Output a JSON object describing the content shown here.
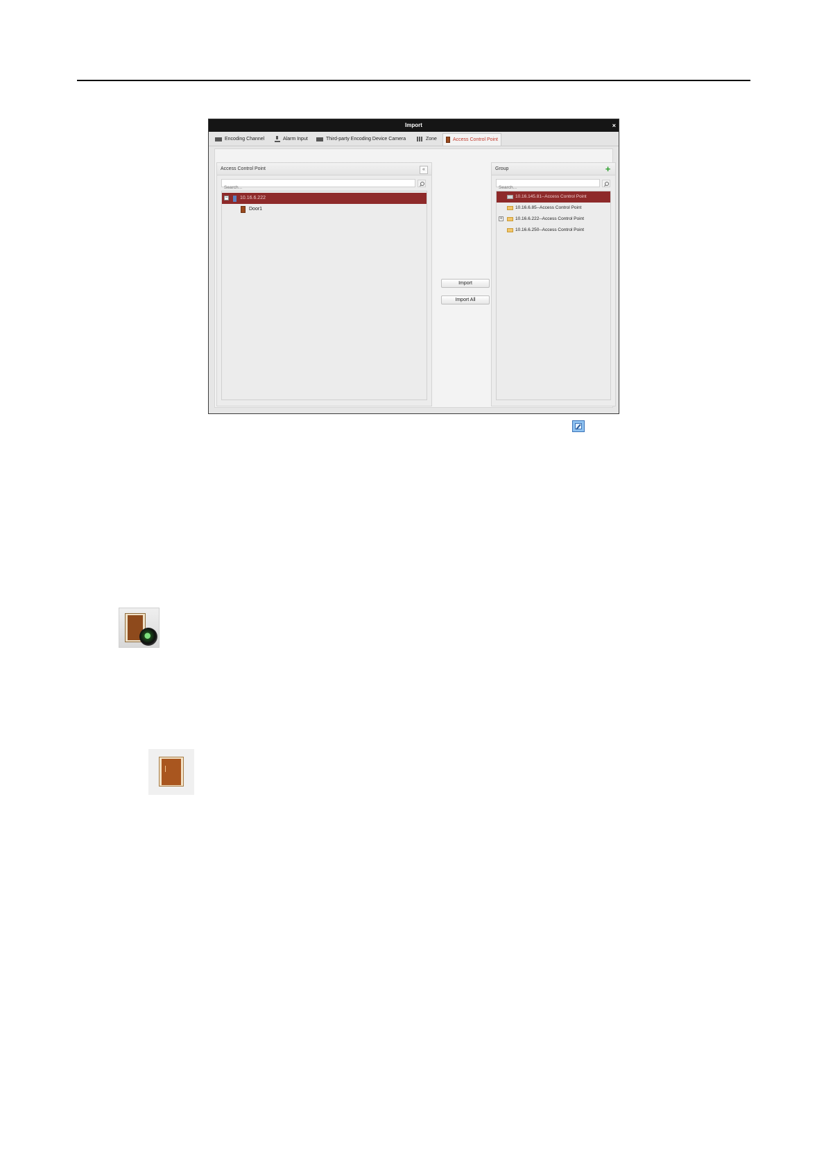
{
  "dialog": {
    "title": "Import",
    "close_glyph": "×",
    "tabs": [
      {
        "label": "Encoding Channel",
        "icon": "camera-icon",
        "active": false
      },
      {
        "label": "Alarm Input",
        "icon": "alarm-input-icon",
        "active": false
      },
      {
        "label": "Third-party Encoding Device Camera",
        "icon": "camera-icon",
        "active": false
      },
      {
        "label": "Zone",
        "icon": "zone-icon",
        "active": false
      },
      {
        "label": "Access Control Point",
        "icon": "door-icon",
        "active": true
      }
    ],
    "left_panel": {
      "title": "Access Control Point",
      "collapse_glyph": "«",
      "search_placeholder": "Search...",
      "tree": [
        {
          "label": "10.16.6.222",
          "expander": "−",
          "icon": "device-icon",
          "selected": true
        },
        {
          "label": "Door1",
          "icon": "door-icon",
          "selected": false
        }
      ]
    },
    "buttons": {
      "import": "Import",
      "import_all": "Import All"
    },
    "right_panel": {
      "title": "Group",
      "add_glyph": "+",
      "search_placeholder": "Search...",
      "tree": [
        {
          "label": "10.16.145.81--Access Control Point",
          "icon": "camera-icon",
          "selected": true
        },
        {
          "label": "10.16.6.85--Access Control Point",
          "icon": "folder-icon",
          "selected": false
        },
        {
          "label": "10.16.6.222--Access Control Point",
          "icon": "folder-icon",
          "expander": "+",
          "selected": false
        },
        {
          "label": "10.16.6.250--Access Control Point",
          "icon": "folder-icon",
          "selected": false
        }
      ]
    }
  },
  "page_icons": [
    "edit-icon",
    "door-camera-icon",
    "door-icon"
  ]
}
